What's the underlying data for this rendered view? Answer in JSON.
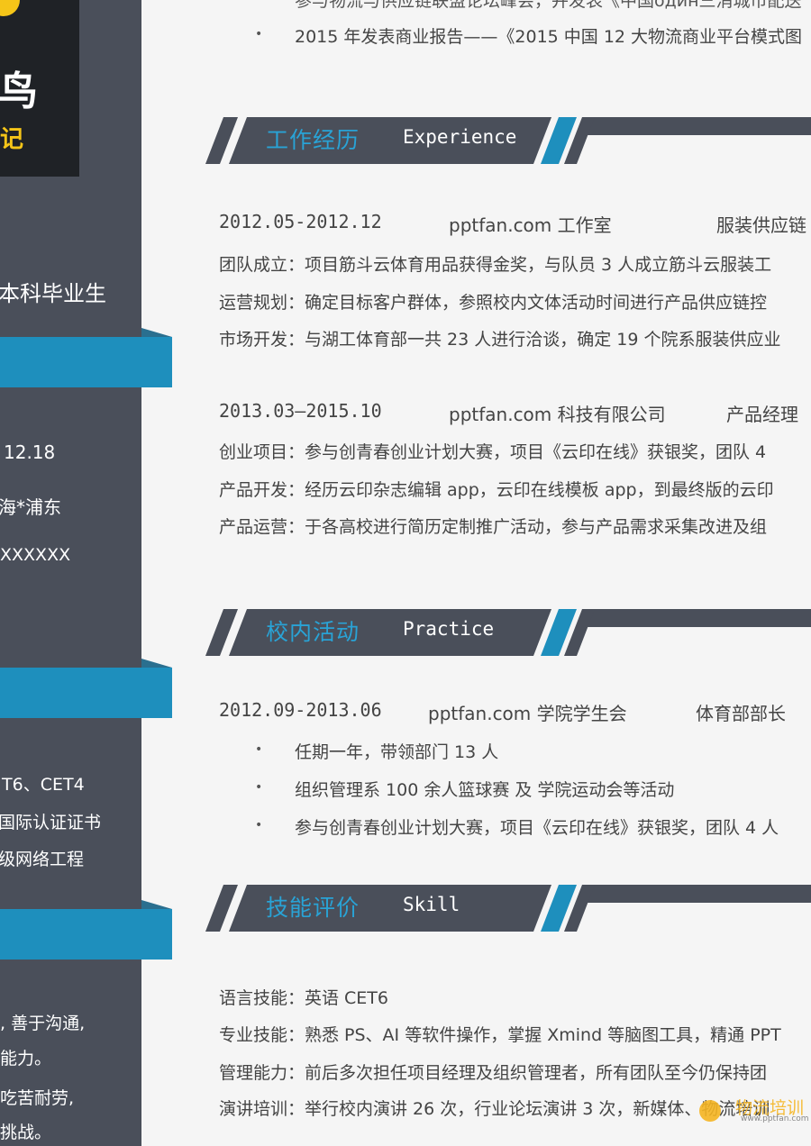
{
  "sidebar": {
    "photo_text_large": "鸟",
    "photo_text_small": "记",
    "degree": "本科毕业生",
    "info": [
      "12.18",
      "海*浦东",
      "XXXXXX"
    ],
    "certs": [
      "T6、CET4",
      "国际认证证书",
      "级网络工程"
    ],
    "traits": [
      ", 善于沟通,",
      "能力。",
      "吃苦耐劳,",
      "挑战。"
    ]
  },
  "top_lines": {
    "partial": "参与物流与供应链联盟论坛峰会，并发表《中国один三消城市配送",
    "report": "2015 年发表商业报告——《2015 中国 12 大物流商业平台模式图"
  },
  "experience": {
    "title_cn": "工作经历",
    "title_en": "Experience",
    "jobs": [
      {
        "period": "2012.05-2012.12",
        "company": "pptfan.com 工作室",
        "role": "服装供应链",
        "lines": [
          "团队成立：项目筋斗云体育用品获得金奖，与队员 3 人成立筋斗云服装工",
          "运营规划：确定目标客户群体，参照校内文体活动时间进行产品供应链控",
          "市场开发：与湖工体育部一共 23 人进行洽谈，确定 19 个院系服装供应业"
        ]
      },
      {
        "period": "2013.03—2015.10",
        "company": "pptfan.com 科技有限公司",
        "role": "产品经理",
        "lines": [
          "创业项目：参与创青春创业计划大赛，项目《云印在线》获银奖，团队 4",
          "产品开发：经历云印杂志编辑 app，云印在线模板 app，到最终版的云印",
          "产品运营：于各高校进行简历定制推广活动，参与产品需求采集改进及组"
        ]
      }
    ]
  },
  "practice": {
    "title_cn": "校内活动",
    "title_en": "Practice",
    "period": "2012.09-2013.06",
    "org": "pptfan.com 学院学生会",
    "role": "体育部部长",
    "bullets": [
      "任期一年，带领部门 13 人",
      "组织管理系 100 余人篮球赛 及 学院运动会等活动",
      "参与创青春创业计划大赛，项目《云印在线》获银奖，团队 4 人"
    ]
  },
  "skill": {
    "title_cn": "技能评价",
    "title_en": "Skill",
    "lines": [
      "语言技能：英语 CET6",
      "专业技能：熟悉 PS、AI 等软件操作，掌握 Xmind 等脑图工具，精通 PPT",
      "管理能力：前后多次担任项目经理及组织管理者，所有团队至今仍保持团",
      "演讲培训：举行校内演讲 26 次，行业论坛演讲 3 次，新媒体、物流培训"
    ]
  },
  "watermark": {
    "title": "物流培训",
    "url": "www.pptfan.com"
  },
  "colors": {
    "sidebar": "#4a4f5a",
    "accent_blue": "#1e8fbd",
    "title_blue": "#29a3d6",
    "header_bar": "#4a4f5a"
  }
}
